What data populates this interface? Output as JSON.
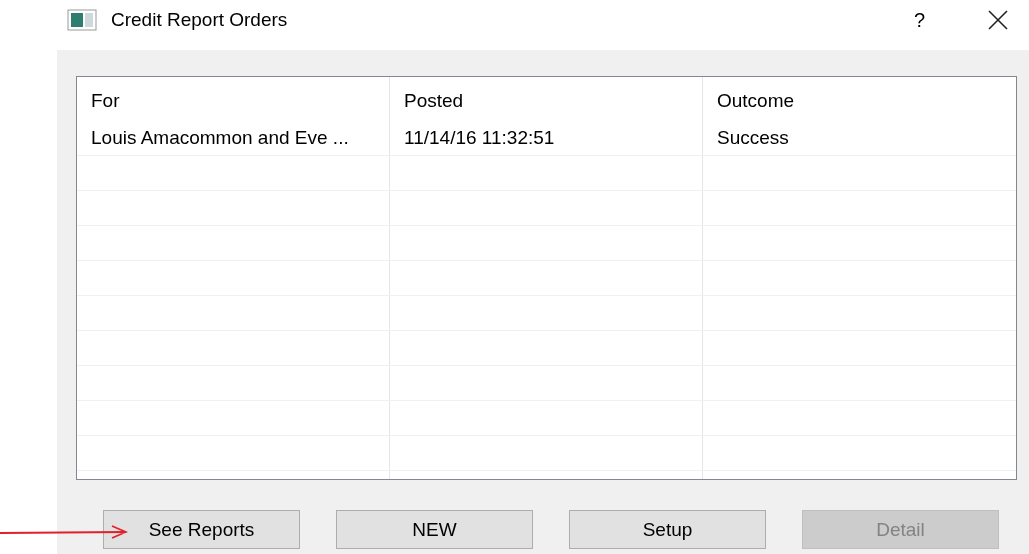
{
  "window": {
    "title": "Credit Report Orders",
    "help": "?"
  },
  "table": {
    "columns": [
      "For",
      "Posted",
      "Outcome"
    ],
    "rows": [
      [
        "Louis Amacommon and Eve ...",
        "11/14/16 11:32:51",
        "Success"
      ]
    ]
  },
  "buttons": [
    {
      "label": "See Reports",
      "disabled": false
    },
    {
      "label": "NEW",
      "disabled": false
    },
    {
      "label": "Setup",
      "disabled": false
    },
    {
      "label": "Detail",
      "disabled": true
    }
  ]
}
